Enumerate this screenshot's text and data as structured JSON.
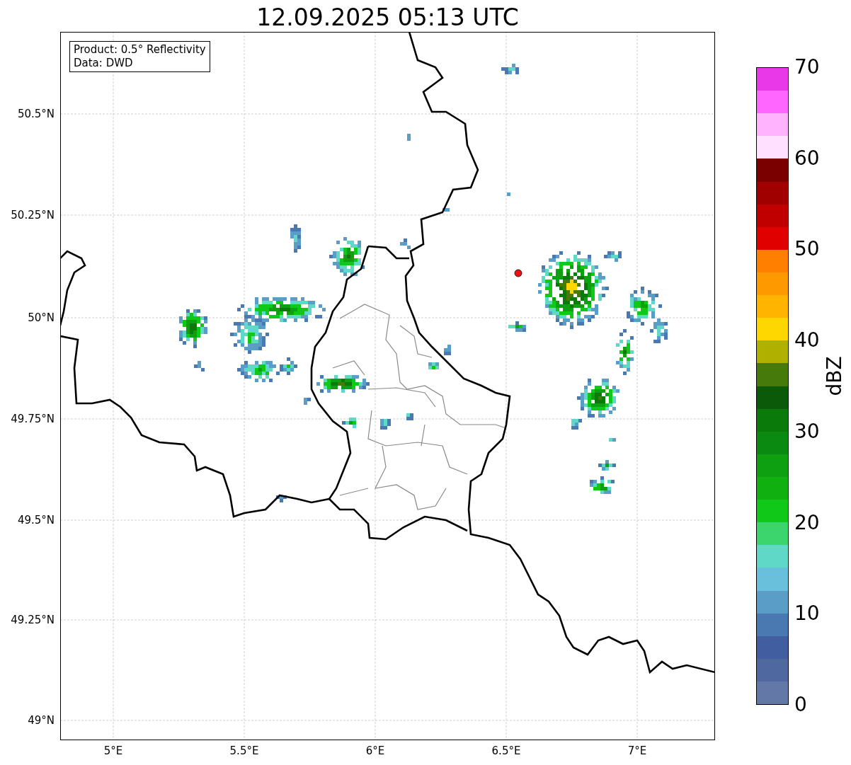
{
  "title": "12.09.2025 05:13 UTC",
  "info_box": {
    "lines": [
      "Product: 0.5° Reflectivity",
      "Data: DWD"
    ]
  },
  "y_axis": {
    "ticks": [
      "50.5°N",
      "50.25°N",
      "50°N",
      "49.75°N",
      "49.5°N",
      "49.25°N",
      "49°N"
    ]
  },
  "x_axis": {
    "ticks": [
      "5°E",
      "5.5°E",
      "6°E",
      "6.5°E",
      "7°E"
    ]
  },
  "colorbar": {
    "label": "dBZ",
    "ticks": [
      "70",
      "60",
      "50",
      "40",
      "30",
      "20",
      "10",
      "0"
    ],
    "segments": [
      {
        "color": "#e838e8"
      },
      {
        "color": "#ff66ff"
      },
      {
        "color": "#ffb3ff"
      },
      {
        "color": "#ffe0ff"
      },
      {
        "color": "#7a0000"
      },
      {
        "color": "#a00000"
      },
      {
        "color": "#c00000"
      },
      {
        "color": "#e00000"
      },
      {
        "color": "#ff7f00"
      },
      {
        "color": "#ff9900"
      },
      {
        "color": "#ffb400"
      },
      {
        "color": "#ffd700"
      },
      {
        "color": "#b0b000"
      },
      {
        "color": "#467a0a"
      },
      {
        "color": "#0a5a0a"
      },
      {
        "color": "#0a7a0a"
      },
      {
        "color": "#0a8a10"
      },
      {
        "color": "#0ea010"
      },
      {
        "color": "#10b010"
      },
      {
        "color": "#10c818"
      },
      {
        "color": "#3cd46c"
      },
      {
        "color": "#60d8c8"
      },
      {
        "color": "#68c0dc"
      },
      {
        "color": "#5a9ec8"
      },
      {
        "color": "#4a78b0"
      },
      {
        "color": "#405ea0"
      },
      {
        "color": "#5068a0"
      },
      {
        "color": "#6478a8"
      }
    ]
  }
}
